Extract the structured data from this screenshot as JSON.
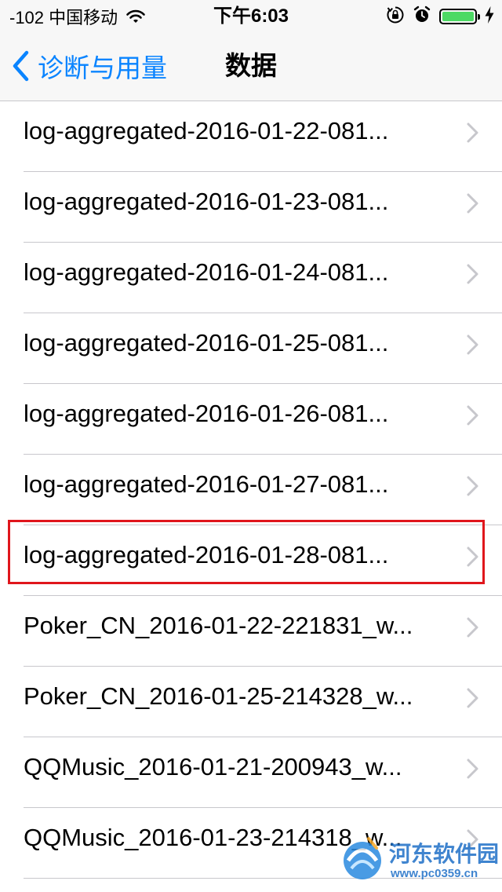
{
  "status_bar": {
    "carrier": "-102 中国移动",
    "time": "下午6:03",
    "battery_color": "#4cd964"
  },
  "nav": {
    "back_label": "诊断与用量",
    "title": "数据",
    "accent_color": "#0a84ff"
  },
  "list": {
    "items": [
      "log-aggregated-2016-01-22-081...",
      "log-aggregated-2016-01-23-081...",
      "log-aggregated-2016-01-24-081...",
      "log-aggregated-2016-01-25-081...",
      "log-aggregated-2016-01-26-081...",
      "log-aggregated-2016-01-27-081...",
      "log-aggregated-2016-01-28-081...",
      "Poker_CN_2016-01-22-221831_w...",
      "Poker_CN_2016-01-25-214328_w...",
      "QQMusic_2016-01-21-200943_w...",
      "QQMusic_2016-01-23-214318_w..."
    ],
    "highlighted_index": 6,
    "highlight_color": "#e0161c"
  },
  "watermark": {
    "name": "河东软件园",
    "url": "www.pc0359.cn"
  }
}
